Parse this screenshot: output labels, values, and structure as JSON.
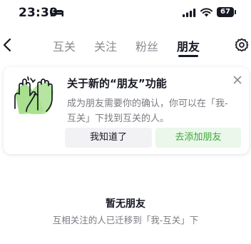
{
  "status_bar": {
    "time": "23:30",
    "battery": "67",
    "icons": [
      "bed-icon",
      "signal-icon",
      "wifi-icon",
      "battery-icon"
    ]
  },
  "nav": {
    "back_icon": "chevron-left-icon",
    "tabs": [
      {
        "label": "互关",
        "active": false
      },
      {
        "label": "关注",
        "active": false
      },
      {
        "label": "粉丝",
        "active": false
      },
      {
        "label": "朋友",
        "active": true
      }
    ],
    "settings_icon": "gear-icon"
  },
  "card": {
    "title": "关于新的“朋友”功能",
    "description": "成为朋友需要你的确认，你可以在「我-互关」下找到互关的人。",
    "confirm_label": "我知道了",
    "add_label": "去添加朋友",
    "colors": {
      "accent_green": "#3fa93b",
      "add_bg": "#eaf7ea",
      "hands_bg": "#a8e08f"
    }
  },
  "empty_state": {
    "title": "暂无朋友",
    "description": "互相关注的人已迁移到「我-互关」下"
  }
}
